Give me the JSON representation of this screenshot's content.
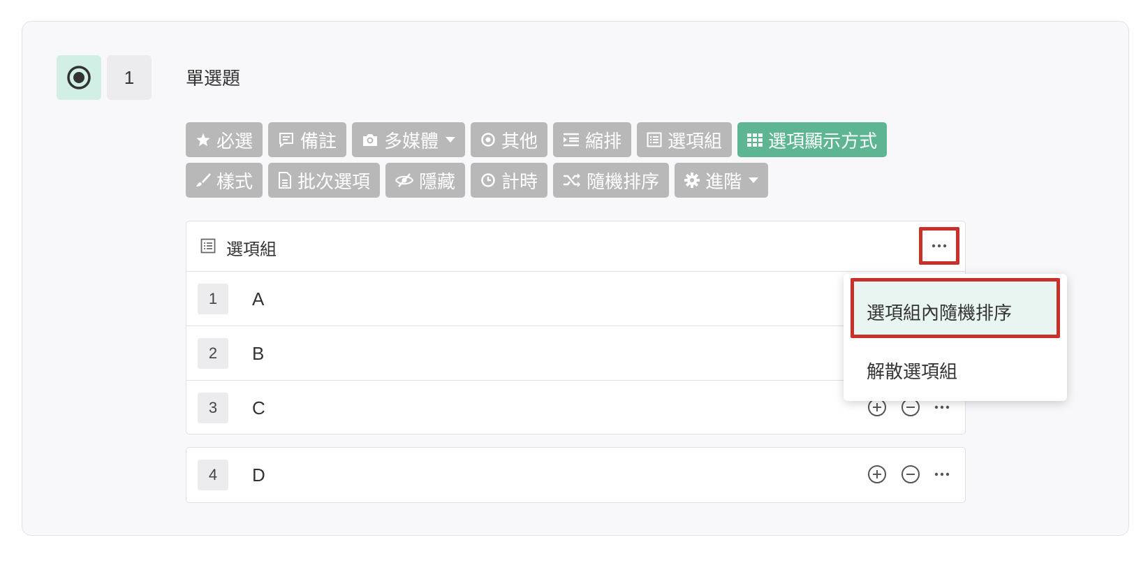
{
  "question": {
    "type_icon": "radio-icon",
    "number": "1",
    "title": "單選題"
  },
  "toolbar_row1": [
    {
      "icon": "star-icon",
      "label": "必選"
    },
    {
      "icon": "comment-icon",
      "label": "備註"
    },
    {
      "icon": "camera-icon",
      "label": "多媒體"
    },
    {
      "icon": "target-icon",
      "label": "其他"
    },
    {
      "icon": "indent-icon",
      "label": "縮排"
    },
    {
      "icon": "list-icon",
      "label": "選項組"
    },
    {
      "icon": "grid-icon",
      "label": "選項顯示方式"
    }
  ],
  "toolbar_row2": [
    {
      "icon": "brush-icon",
      "label": "樣式"
    },
    {
      "icon": "file-icon",
      "label": "批次選項"
    },
    {
      "icon": "eye-slash-icon",
      "label": "隱藏"
    },
    {
      "icon": "clock-icon",
      "label": "計時"
    },
    {
      "icon": "shuffle-icon",
      "label": "隨機排序"
    },
    {
      "icon": "gear-icon",
      "label": "進階"
    }
  ],
  "option_group": {
    "label": "選項組",
    "options": [
      {
        "num": "1",
        "text": "A"
      },
      {
        "num": "2",
        "text": "B"
      },
      {
        "num": "3",
        "text": "C"
      }
    ]
  },
  "standalone_option": {
    "num": "4",
    "text": "D"
  },
  "dropdown": {
    "items": [
      "選項組內隨機排序",
      "解散選項組"
    ]
  },
  "colors": {
    "accent_green": "#5db592",
    "toolbar_gray": "#b8b8b8",
    "highlight_red": "#c8302b"
  }
}
